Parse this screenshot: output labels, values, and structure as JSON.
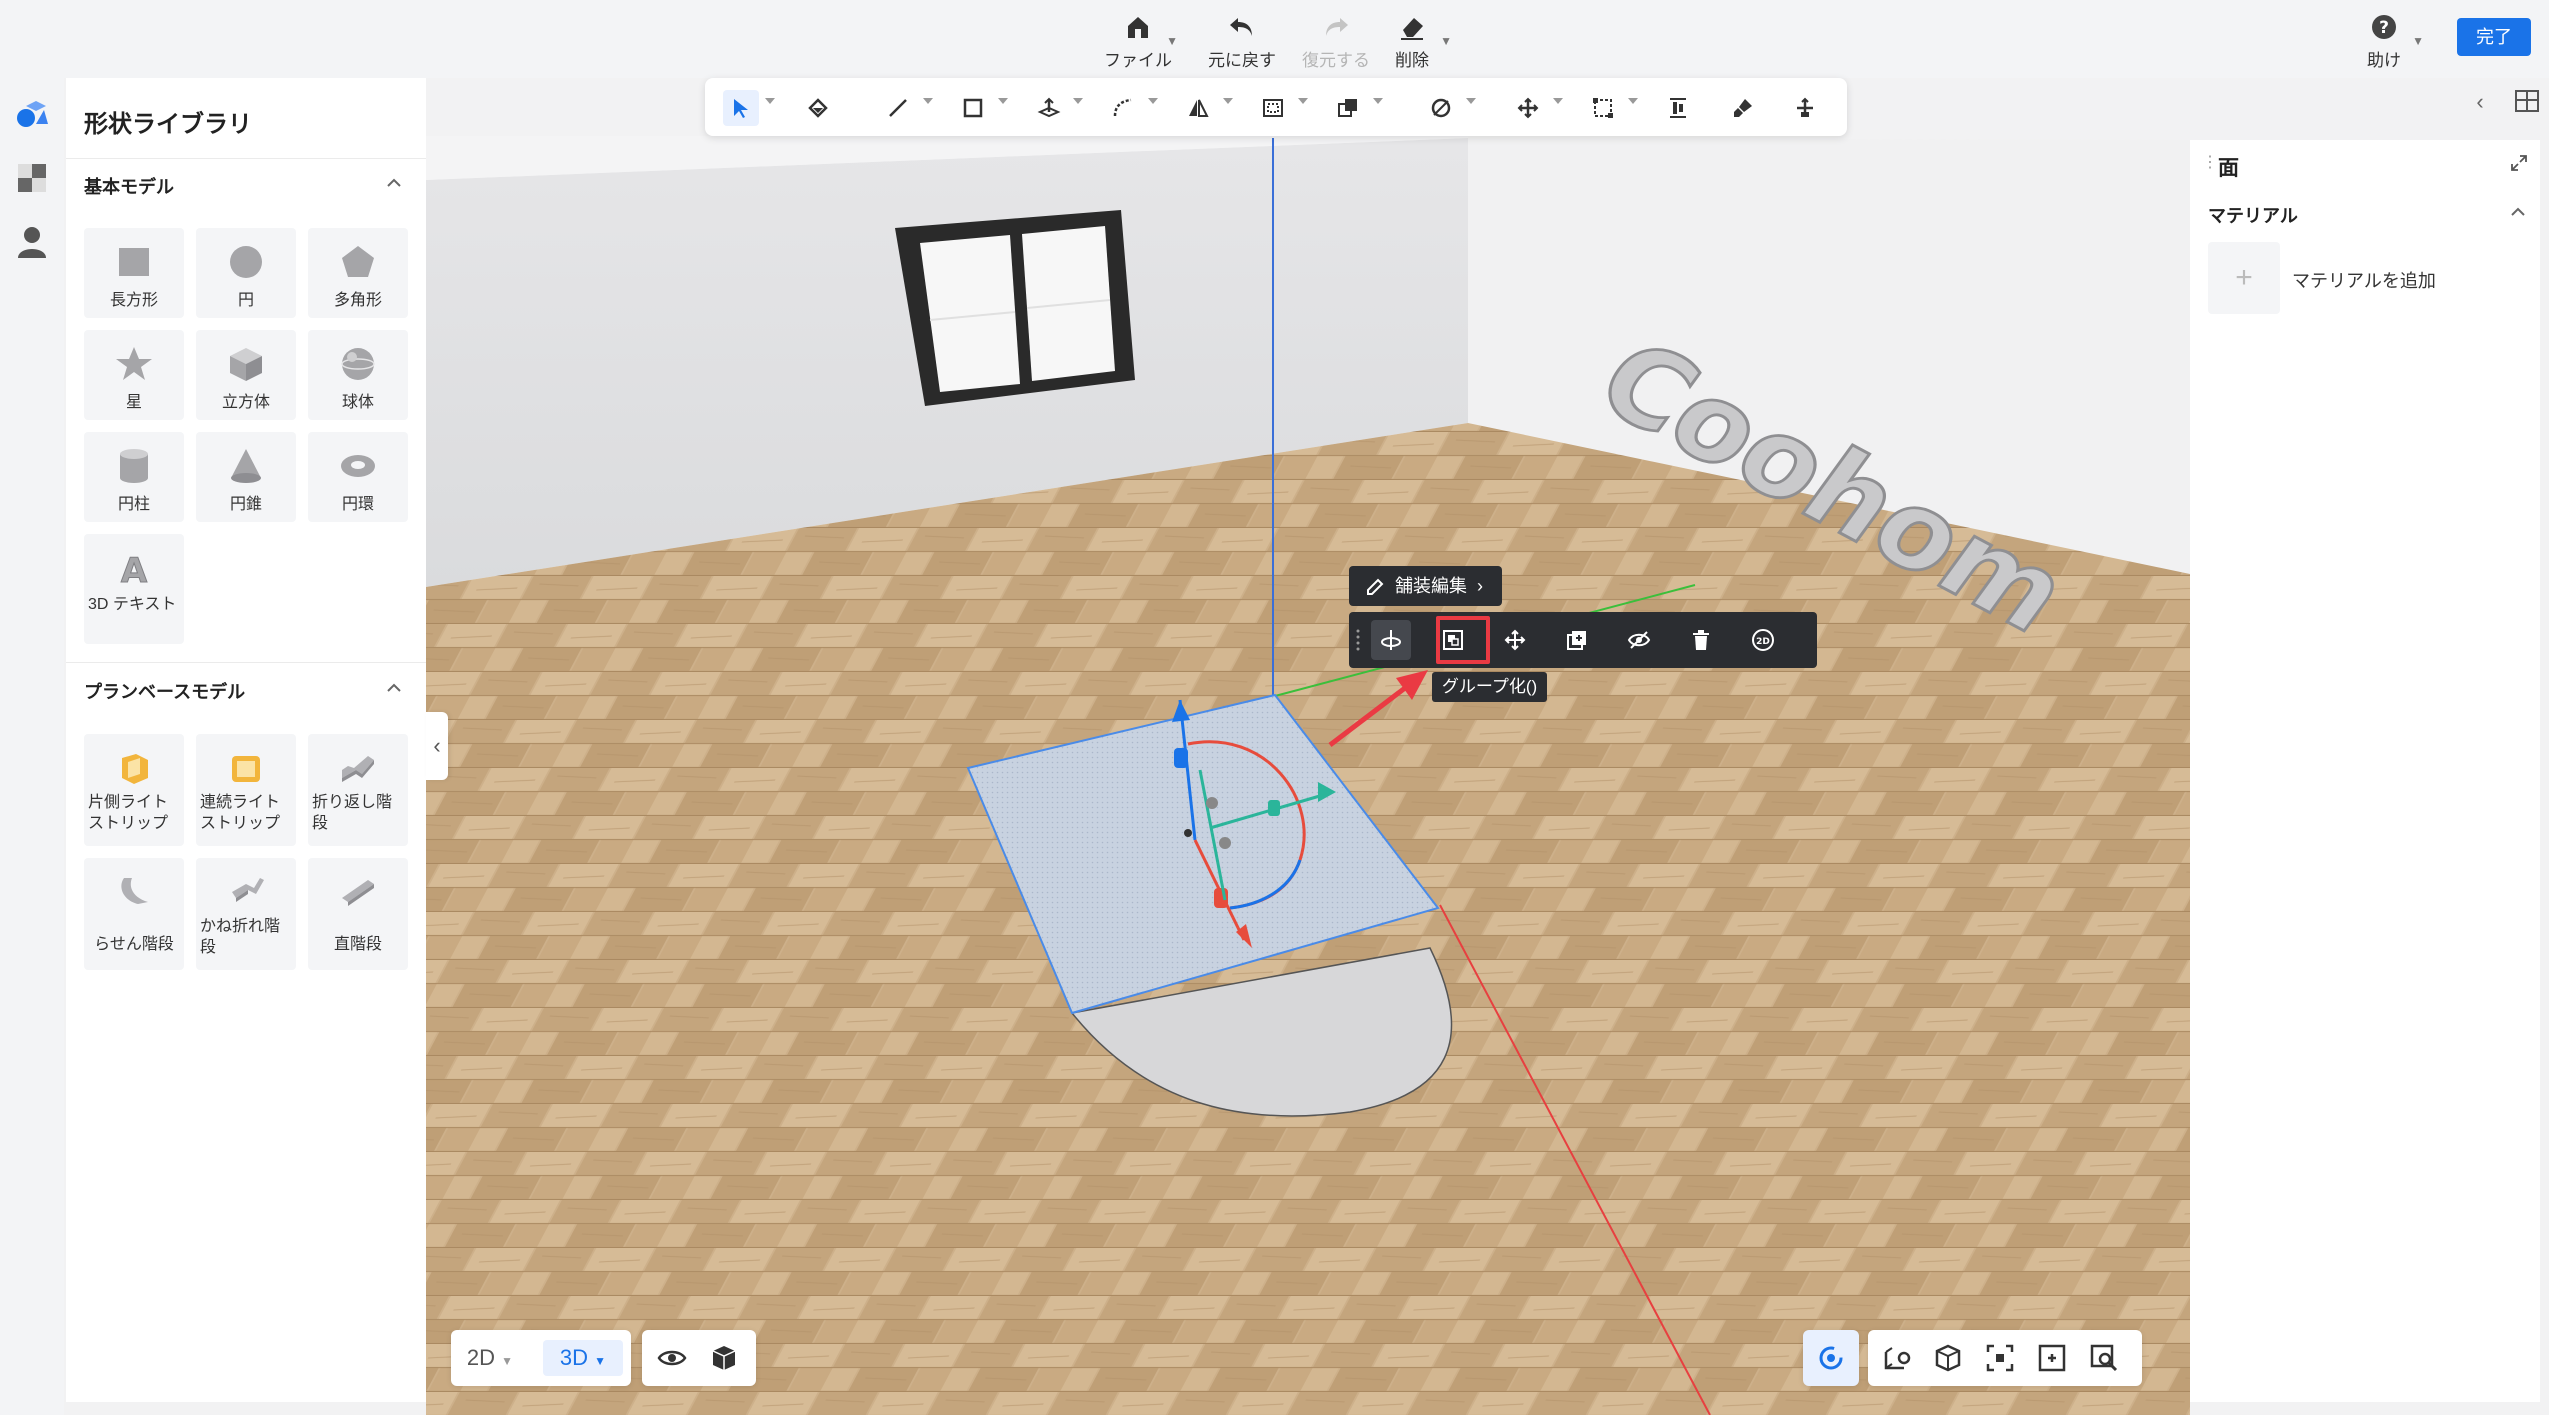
{
  "top": {
    "file": "ファイル",
    "undo": "元に戻す",
    "redo": "復元する",
    "delete": "削除",
    "help": "助け",
    "done": "完了"
  },
  "left_panel": {
    "title": "形状ライブラリ",
    "basic_section": "基本モデル",
    "basic_items": [
      "長方形",
      "円",
      "多角形",
      "星",
      "立方体",
      "球体",
      "円柱",
      "円錐",
      "円環",
      "3D テキスト"
    ],
    "plan_section": "プランベースモデル",
    "plan_items": [
      "片側ライトストリップ",
      "連続ライトストリップ",
      "折り返し階段",
      "らせん階段",
      "かね折れ階段",
      "直階段"
    ]
  },
  "right_panel": {
    "title": "面",
    "material_section": "マテリアル",
    "add_material": "マテリアルを追加"
  },
  "context": {
    "paving_edit": "舗装編集",
    "tooltip": "グループ化()"
  },
  "scene": {
    "wall_text": "Coohom"
  },
  "bottom": {
    "btn_2d": "2D",
    "btn_3d": "3D"
  },
  "colors": {
    "accent": "#1a73e8",
    "highlight": "#ea3a43",
    "dark_bar": "#2b2d31"
  },
  "icons": [
    "home-icon",
    "undo-icon",
    "redo-icon",
    "eraser-icon",
    "help-icon",
    "select-arrow-icon",
    "paint-bucket-icon",
    "line-icon",
    "rectangle-icon",
    "push-pull-icon",
    "arc-icon",
    "mirror-icon",
    "offset-icon",
    "combine-icon",
    "tape-icon",
    "move-icon",
    "scale-icon",
    "align-icon",
    "brush-icon",
    "pan-icon",
    "group-icon",
    "hide-icon",
    "trash-icon",
    "2d-icon",
    "eye-icon",
    "cube-icon",
    "orbit-icon"
  ]
}
